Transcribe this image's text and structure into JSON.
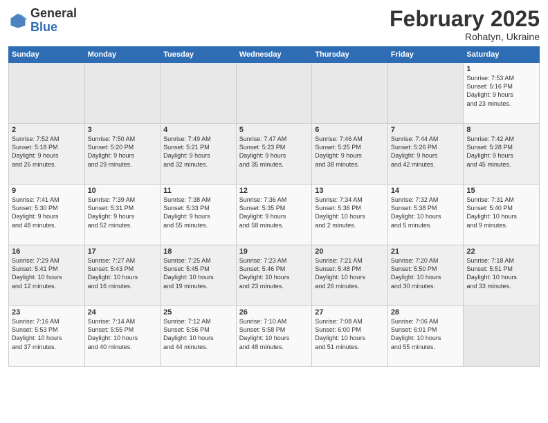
{
  "header": {
    "logo_general": "General",
    "logo_blue": "Blue",
    "month_title": "February 2025",
    "location": "Rohatyn, Ukraine"
  },
  "days_of_week": [
    "Sunday",
    "Monday",
    "Tuesday",
    "Wednesday",
    "Thursday",
    "Friday",
    "Saturday"
  ],
  "weeks": [
    [
      {
        "day": "",
        "info": ""
      },
      {
        "day": "",
        "info": ""
      },
      {
        "day": "",
        "info": ""
      },
      {
        "day": "",
        "info": ""
      },
      {
        "day": "",
        "info": ""
      },
      {
        "day": "",
        "info": ""
      },
      {
        "day": "1",
        "info": "Sunrise: 7:53 AM\nSunset: 5:16 PM\nDaylight: 9 hours\nand 23 minutes."
      }
    ],
    [
      {
        "day": "2",
        "info": "Sunrise: 7:52 AM\nSunset: 5:18 PM\nDaylight: 9 hours\nand 26 minutes."
      },
      {
        "day": "3",
        "info": "Sunrise: 7:50 AM\nSunset: 5:20 PM\nDaylight: 9 hours\nand 29 minutes."
      },
      {
        "day": "4",
        "info": "Sunrise: 7:49 AM\nSunset: 5:21 PM\nDaylight: 9 hours\nand 32 minutes."
      },
      {
        "day": "5",
        "info": "Sunrise: 7:47 AM\nSunset: 5:23 PM\nDaylight: 9 hours\nand 35 minutes."
      },
      {
        "day": "6",
        "info": "Sunrise: 7:46 AM\nSunset: 5:25 PM\nDaylight: 9 hours\nand 38 minutes."
      },
      {
        "day": "7",
        "info": "Sunrise: 7:44 AM\nSunset: 5:26 PM\nDaylight: 9 hours\nand 42 minutes."
      },
      {
        "day": "8",
        "info": "Sunrise: 7:42 AM\nSunset: 5:28 PM\nDaylight: 9 hours\nand 45 minutes."
      }
    ],
    [
      {
        "day": "9",
        "info": "Sunrise: 7:41 AM\nSunset: 5:30 PM\nDaylight: 9 hours\nand 48 minutes."
      },
      {
        "day": "10",
        "info": "Sunrise: 7:39 AM\nSunset: 5:31 PM\nDaylight: 9 hours\nand 52 minutes."
      },
      {
        "day": "11",
        "info": "Sunrise: 7:38 AM\nSunset: 5:33 PM\nDaylight: 9 hours\nand 55 minutes."
      },
      {
        "day": "12",
        "info": "Sunrise: 7:36 AM\nSunset: 5:35 PM\nDaylight: 9 hours\nand 58 minutes."
      },
      {
        "day": "13",
        "info": "Sunrise: 7:34 AM\nSunset: 5:36 PM\nDaylight: 10 hours\nand 2 minutes."
      },
      {
        "day": "14",
        "info": "Sunrise: 7:32 AM\nSunset: 5:38 PM\nDaylight: 10 hours\nand 5 minutes."
      },
      {
        "day": "15",
        "info": "Sunrise: 7:31 AM\nSunset: 5:40 PM\nDaylight: 10 hours\nand 9 minutes."
      }
    ],
    [
      {
        "day": "16",
        "info": "Sunrise: 7:29 AM\nSunset: 5:41 PM\nDaylight: 10 hours\nand 12 minutes."
      },
      {
        "day": "17",
        "info": "Sunrise: 7:27 AM\nSunset: 5:43 PM\nDaylight: 10 hours\nand 16 minutes."
      },
      {
        "day": "18",
        "info": "Sunrise: 7:25 AM\nSunset: 5:45 PM\nDaylight: 10 hours\nand 19 minutes."
      },
      {
        "day": "19",
        "info": "Sunrise: 7:23 AM\nSunset: 5:46 PM\nDaylight: 10 hours\nand 23 minutes."
      },
      {
        "day": "20",
        "info": "Sunrise: 7:21 AM\nSunset: 5:48 PM\nDaylight: 10 hours\nand 26 minutes."
      },
      {
        "day": "21",
        "info": "Sunrise: 7:20 AM\nSunset: 5:50 PM\nDaylight: 10 hours\nand 30 minutes."
      },
      {
        "day": "22",
        "info": "Sunrise: 7:18 AM\nSunset: 5:51 PM\nDaylight: 10 hours\nand 33 minutes."
      }
    ],
    [
      {
        "day": "23",
        "info": "Sunrise: 7:16 AM\nSunset: 5:53 PM\nDaylight: 10 hours\nand 37 minutes."
      },
      {
        "day": "24",
        "info": "Sunrise: 7:14 AM\nSunset: 5:55 PM\nDaylight: 10 hours\nand 40 minutes."
      },
      {
        "day": "25",
        "info": "Sunrise: 7:12 AM\nSunset: 5:56 PM\nDaylight: 10 hours\nand 44 minutes."
      },
      {
        "day": "26",
        "info": "Sunrise: 7:10 AM\nSunset: 5:58 PM\nDaylight: 10 hours\nand 48 minutes."
      },
      {
        "day": "27",
        "info": "Sunrise: 7:08 AM\nSunset: 6:00 PM\nDaylight: 10 hours\nand 51 minutes."
      },
      {
        "day": "28",
        "info": "Sunrise: 7:06 AM\nSunset: 6:01 PM\nDaylight: 10 hours\nand 55 minutes."
      },
      {
        "day": "",
        "info": ""
      }
    ]
  ]
}
